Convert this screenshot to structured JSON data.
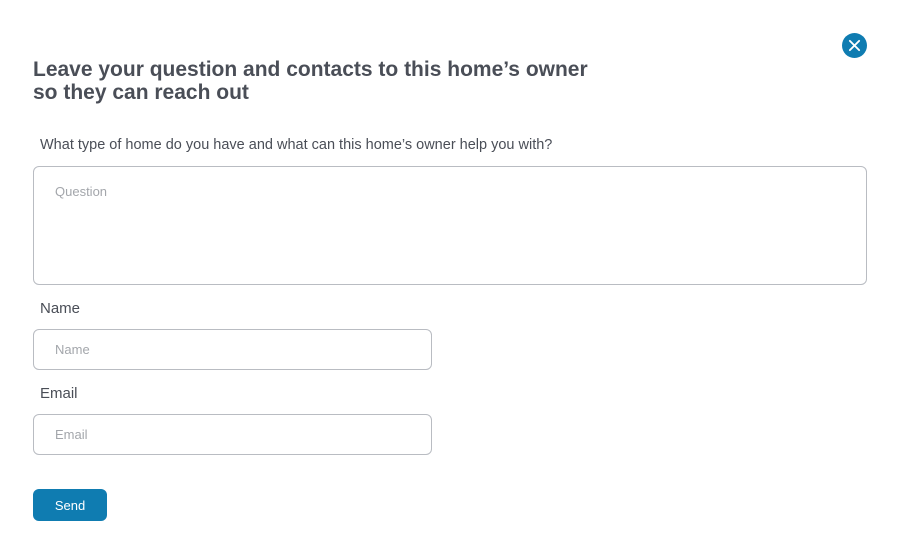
{
  "modal": {
    "title_line1": "Leave your question and contacts to this home’s owner",
    "title_line2": "so they can reach out",
    "close_icon": "close-icon",
    "accent_color": "#0f7cb1"
  },
  "form": {
    "question": {
      "label": "What type of home do you have and what can this home’s owner help you with?",
      "placeholder": "Question",
      "value": ""
    },
    "name": {
      "label": "Name",
      "placeholder": "Name",
      "value": ""
    },
    "email": {
      "label": "Email",
      "placeholder": "Email",
      "value": ""
    },
    "send_label": "Send"
  }
}
